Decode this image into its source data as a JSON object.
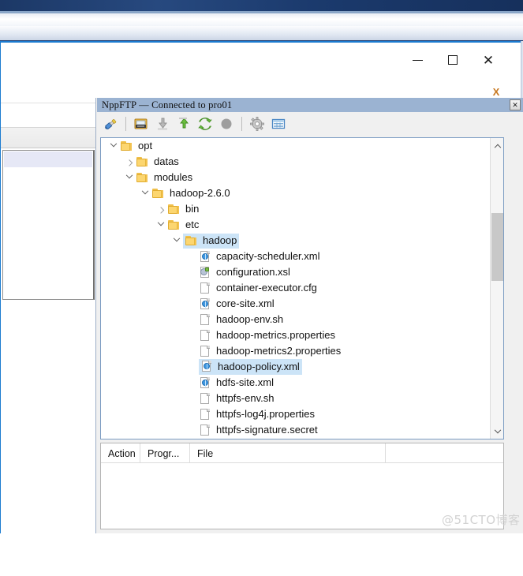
{
  "window": {
    "minimize_label": "—",
    "maximize_label": "□",
    "close_label": "✕",
    "tab_close_label": "X"
  },
  "ftp_panel": {
    "title": "NppFTP — Connected to pro01",
    "close_label": "✕",
    "toolbar": [
      {
        "name": "connect-icon",
        "tooltip": "Connect"
      },
      {
        "name": "open-folder-icon",
        "tooltip": "Open directory"
      },
      {
        "name": "download-icon",
        "tooltip": "Download"
      },
      {
        "name": "upload-icon",
        "tooltip": "Upload"
      },
      {
        "name": "refresh-icon",
        "tooltip": "Refresh"
      },
      {
        "name": "abort-icon",
        "tooltip": "Abort"
      },
      {
        "name": "settings-gear-icon",
        "tooltip": "Settings"
      },
      {
        "name": "message-panel-icon",
        "tooltip": "Show messages"
      }
    ]
  },
  "tree": {
    "nodes": [
      {
        "label": "opt",
        "depth": 0,
        "kind": "folder",
        "state": "expanded",
        "selected": false
      },
      {
        "label": "datas",
        "depth": 1,
        "kind": "folder",
        "state": "collapsed",
        "selected": false
      },
      {
        "label": "modules",
        "depth": 1,
        "kind": "folder",
        "state": "expanded",
        "selected": false
      },
      {
        "label": "hadoop-2.6.0",
        "depth": 2,
        "kind": "folder",
        "state": "expanded",
        "selected": false
      },
      {
        "label": "bin",
        "depth": 3,
        "kind": "folder",
        "state": "collapsed",
        "selected": false
      },
      {
        "label": "etc",
        "depth": 3,
        "kind": "folder",
        "state": "expanded",
        "selected": false
      },
      {
        "label": "hadoop",
        "depth": 4,
        "kind": "folder",
        "state": "expanded",
        "selected": true
      },
      {
        "label": "capacity-scheduler.xml",
        "depth": 5,
        "kind": "xml",
        "state": "leaf",
        "selected": false
      },
      {
        "label": "configuration.xsl",
        "depth": 5,
        "kind": "xsl",
        "state": "leaf",
        "selected": false
      },
      {
        "label": "container-executor.cfg",
        "depth": 5,
        "kind": "file",
        "state": "leaf",
        "selected": false
      },
      {
        "label": "core-site.xml",
        "depth": 5,
        "kind": "xml",
        "state": "leaf",
        "selected": false
      },
      {
        "label": "hadoop-env.sh",
        "depth": 5,
        "kind": "file",
        "state": "leaf",
        "selected": false
      },
      {
        "label": "hadoop-metrics.properties",
        "depth": 5,
        "kind": "file",
        "state": "leaf",
        "selected": false
      },
      {
        "label": "hadoop-metrics2.properties",
        "depth": 5,
        "kind": "file",
        "state": "leaf",
        "selected": false
      },
      {
        "label": "hadoop-policy.xml",
        "depth": 5,
        "kind": "xml",
        "state": "leaf",
        "selected": true
      },
      {
        "label": "hdfs-site.xml",
        "depth": 5,
        "kind": "xml",
        "state": "leaf",
        "selected": false
      },
      {
        "label": "httpfs-env.sh",
        "depth": 5,
        "kind": "file",
        "state": "leaf",
        "selected": false
      },
      {
        "label": "httpfs-log4j.properties",
        "depth": 5,
        "kind": "file",
        "state": "leaf",
        "selected": false
      },
      {
        "label": "httpfs-signature.secret",
        "depth": 5,
        "kind": "file",
        "state": "leaf",
        "selected": false
      }
    ]
  },
  "queue": {
    "columns": [
      "Action",
      "Progr...",
      "File"
    ],
    "rows": []
  },
  "watermark": "@51CTO博客",
  "colors": {
    "selection": "#cce4f7",
    "ftp_titlebar": "#9bb3d2",
    "folder": "#fcd670",
    "accent_border": "#1b7bd0"
  }
}
